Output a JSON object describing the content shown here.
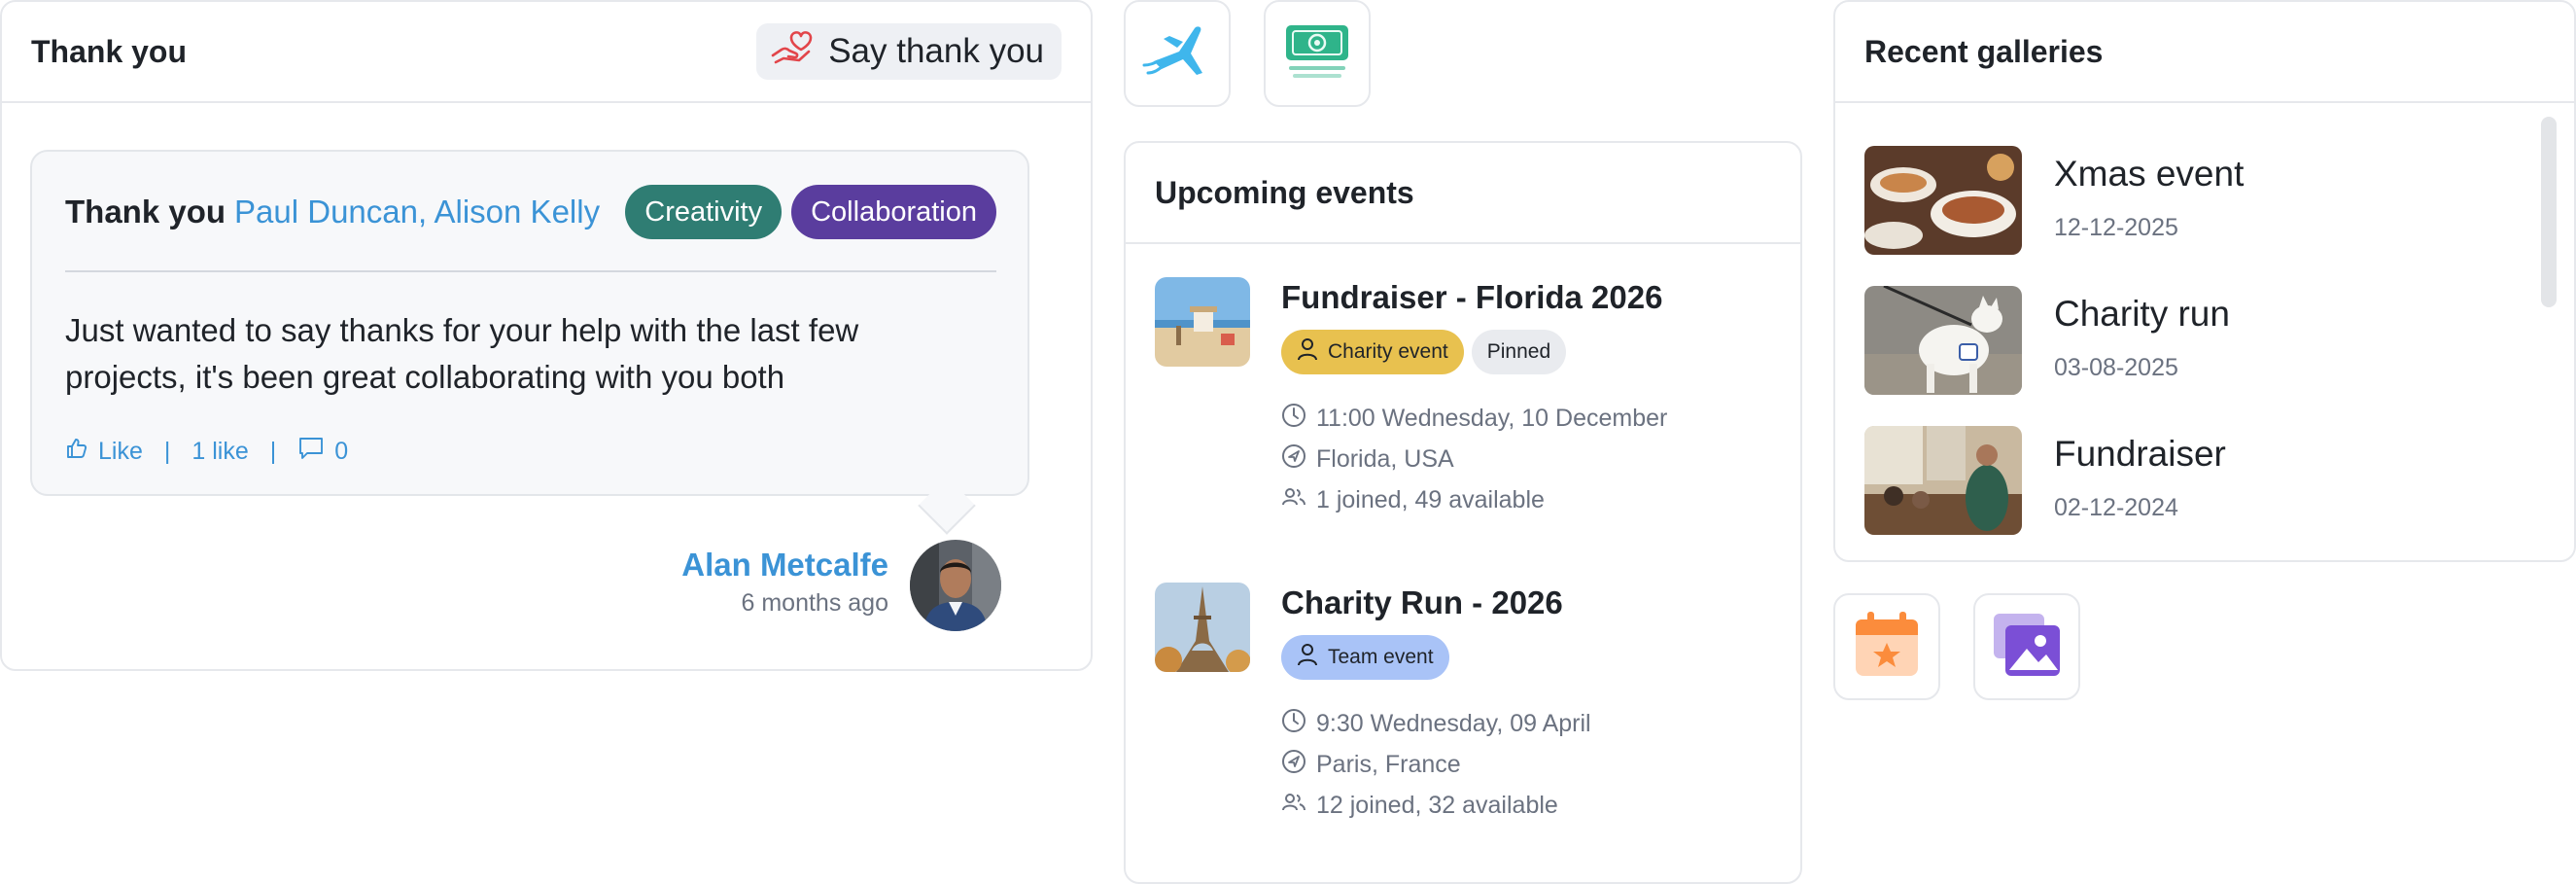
{
  "thank_you": {
    "title": "Thank you",
    "say_thanks_label": "Say thank you",
    "post": {
      "lead": "Thank you",
      "recipients": "Paul Duncan, Alison Kelly",
      "tags": [
        {
          "label": "Creativity",
          "color": "#2f7d73"
        },
        {
          "label": "Collaboration",
          "color": "#5a3d9e"
        }
      ],
      "message_line1": "Just wanted to say thanks for your help with the last few",
      "message_line2": "projects, it's been great collaborating with you both",
      "like_label": "Like",
      "like_count": "1 like",
      "comment_count": "0"
    },
    "author": {
      "name": "Alan Metcalfe",
      "time": "6 months ago"
    }
  },
  "quick_tiles": {
    "travel": "airplane-icon",
    "payments": "money-icon",
    "calendar": "calendar-star-icon",
    "images": "images-icon"
  },
  "events": {
    "title": "Upcoming events",
    "items": [
      {
        "title": "Fundraiser - Florida 2026",
        "tags": [
          {
            "label": "Charity event",
            "color": "#e8c14f",
            "icon": "user-icon"
          },
          {
            "label": "Pinned",
            "color": "#e9ebef"
          }
        ],
        "time": "11:00 Wednesday, 10 December",
        "location": "Florida, USA",
        "attendance": "1 joined, 49 available"
      },
      {
        "title": "Charity Run - 2026",
        "tags": [
          {
            "label": "Team event",
            "color": "#a9c3f7",
            "icon": "user-icon"
          }
        ],
        "time": "9:30 Wednesday, 09 April",
        "location": "Paris, France",
        "attendance": "12 joined, 32 available"
      }
    ]
  },
  "galleries": {
    "title": "Recent galleries",
    "items": [
      {
        "title": "Xmas event",
        "date": "12-12-2025"
      },
      {
        "title": "Charity run",
        "date": "03-08-2025"
      },
      {
        "title": "Fundraiser",
        "date": "02-12-2024"
      }
    ]
  },
  "colors": {
    "accent_blue": "#3b93d6",
    "border": "#e6e8ec",
    "muted_text": "#6b7280"
  }
}
